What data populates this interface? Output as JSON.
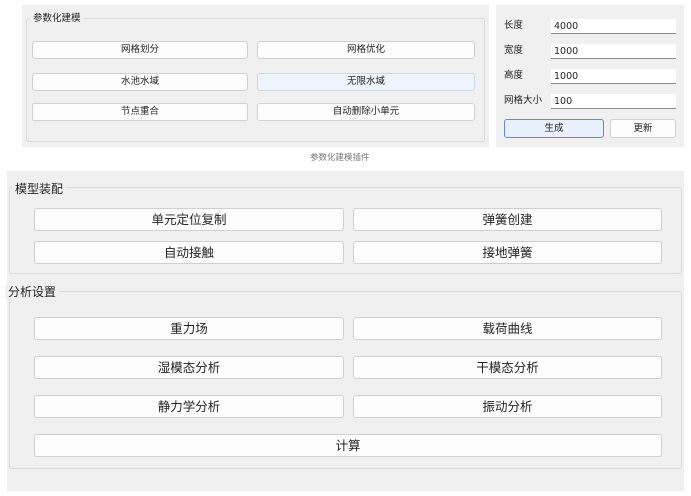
{
  "param_panel": {
    "group_title": "参数化建模",
    "buttons": [
      "网格划分",
      "网格优化",
      "水池水域",
      "无限水域",
      "节点重合",
      "自动删除小单元"
    ]
  },
  "dims": {
    "length_label": "长度",
    "length_value": "4000",
    "width_label": "宽度",
    "width_value": "1000",
    "height_label": "高度",
    "height_value": "1000",
    "mesh_label": "网格大小",
    "mesh_value": "100",
    "generate_label": "生成",
    "update_label": "更新"
  },
  "plugin_caption": "参数化建模插件",
  "assembly": {
    "title": "模型装配",
    "buttons": [
      "单元定位复制",
      "弹簧创建",
      "自动接触",
      "接地弹簧"
    ]
  },
  "analysis": {
    "title": "分析设置",
    "buttons": [
      "重力场",
      "载荷曲线",
      "湿模态分析",
      "干模态分析",
      "静力学分析",
      "振动分析",
      "计算"
    ]
  }
}
